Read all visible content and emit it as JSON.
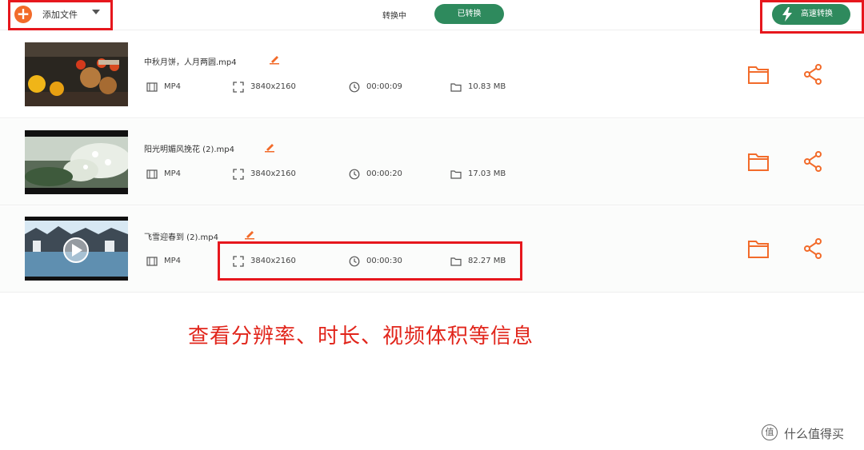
{
  "toolbar": {
    "add_label": "添加文件",
    "tab_converting": "转换中",
    "tab_converted": "已转换",
    "fast_convert_label": "高速转换"
  },
  "files": [
    {
      "name": "中秋月饼，人月两圆.mp4",
      "format": "MP4",
      "resolution": "3840x2160",
      "duration": "00:00:09",
      "size": "10.83 MB"
    },
    {
      "name": "阳光明媚风挽花 (2).mp4",
      "format": "MP4",
      "resolution": "3840x2160",
      "duration": "00:00:20",
      "size": "17.03 MB"
    },
    {
      "name": "飞雪迎春到 (2).mp4",
      "format": "MP4",
      "resolution": "3840x2160",
      "duration": "00:00:30",
      "size": "82.27 MB"
    }
  ],
  "annotation": {
    "caption": "查看分辨率、时长、视频体积等信息",
    "color": "#e1251b"
  },
  "watermark": {
    "logo": "值",
    "text": "什么值得买"
  },
  "colors": {
    "accent_orange": "#f26b2a",
    "green": "#2e8a5d"
  }
}
